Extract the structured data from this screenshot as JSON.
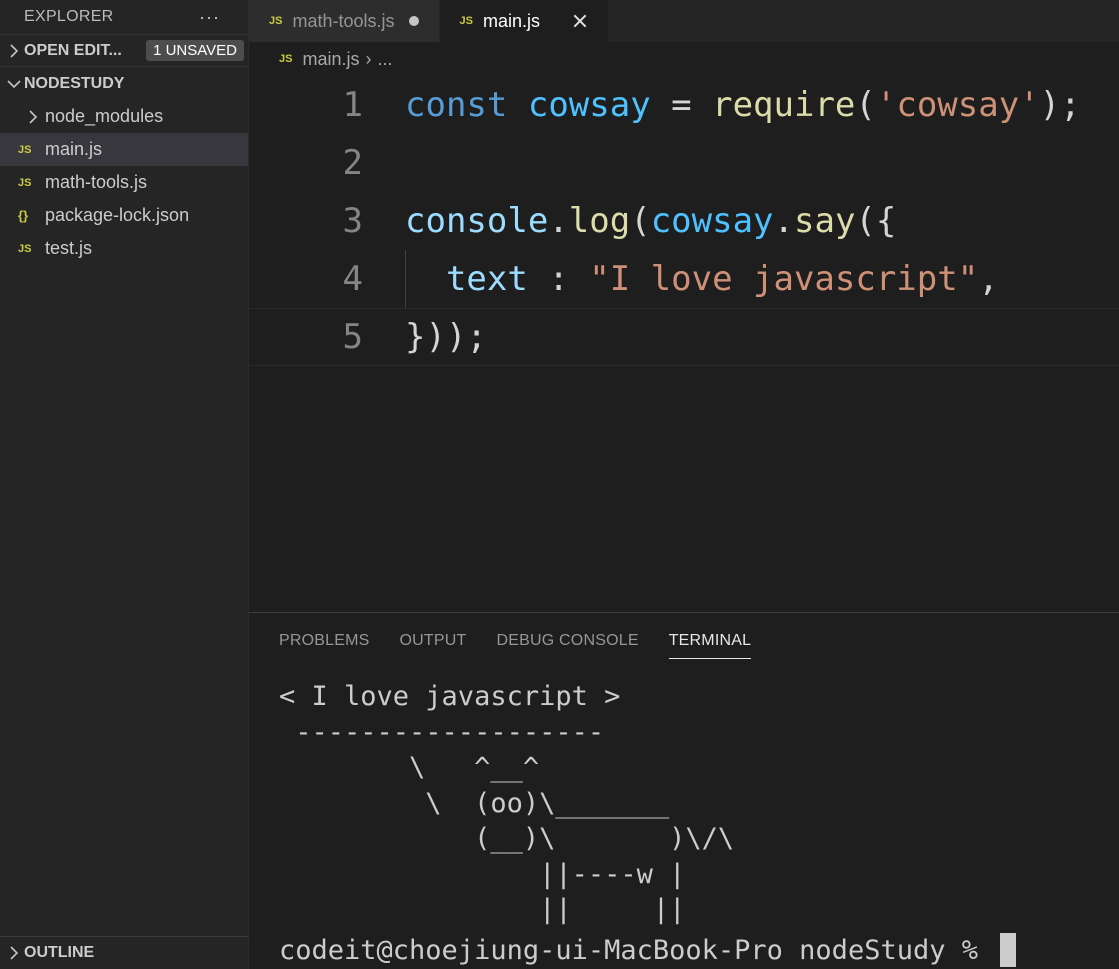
{
  "explorer": {
    "title": "EXPLORER",
    "more_icon": "ellipsis-icon",
    "more_label": "···",
    "open_editors": {
      "label": "OPEN EDIT...",
      "badge": "1 UNSAVED"
    },
    "folder": {
      "label": "NODESTUDY",
      "items": [
        {
          "label": "node_modules",
          "type": "folder"
        },
        {
          "label": "main.js",
          "type": "js",
          "active": true
        },
        {
          "label": "math-tools.js",
          "type": "js"
        },
        {
          "label": "package-lock.json",
          "type": "json"
        },
        {
          "label": "test.js",
          "type": "js"
        }
      ]
    },
    "outline": "OUTLINE"
  },
  "tabs": [
    {
      "label": "math-tools.js",
      "icon": "JS",
      "unsaved": true
    },
    {
      "label": "main.js",
      "icon": "JS",
      "active": true
    }
  ],
  "breadcrumb": {
    "file": "main.js",
    "rest": "..."
  },
  "editor": {
    "lines": [
      {
        "n": "1"
      },
      {
        "n": "2"
      },
      {
        "n": "3"
      },
      {
        "n": "4"
      },
      {
        "n": "5"
      }
    ],
    "tokens": {
      "l1_kw": "const",
      "l1_var": "cowsay",
      "l1_eq": " = ",
      "l1_fn": "require",
      "l1_p1": "(",
      "l1_str": "'cowsay'",
      "l1_end": ");",
      "l3_var": "console",
      "l3_dot": ".",
      "l3_fn": "log",
      "l3_p": "(",
      "l3_var2": "cowsay",
      "l3_dot2": ".",
      "l3_fn2": "say",
      "l3_end": "({",
      "l4_prop": "text",
      "l4_colon": " : ",
      "l4_str": "\"I love javascript\"",
      "l4_end": ",",
      "l5": "}));"
    }
  },
  "panel": {
    "tabs": [
      "PROBLEMS",
      "OUTPUT",
      "DEBUG CONSOLE",
      "TERMINAL"
    ],
    "active_tab": "TERMINAL",
    "terminal_output": "< I love javascript >\n -------------------\n        \\   ^__^\n         \\  (oo)\\_______\n            (__)\\       )\\/\\\n                ||----w |\n                ||     ||",
    "prompt": "codeit@choejiung-ui-MacBook-Pro nodeStudy % "
  }
}
